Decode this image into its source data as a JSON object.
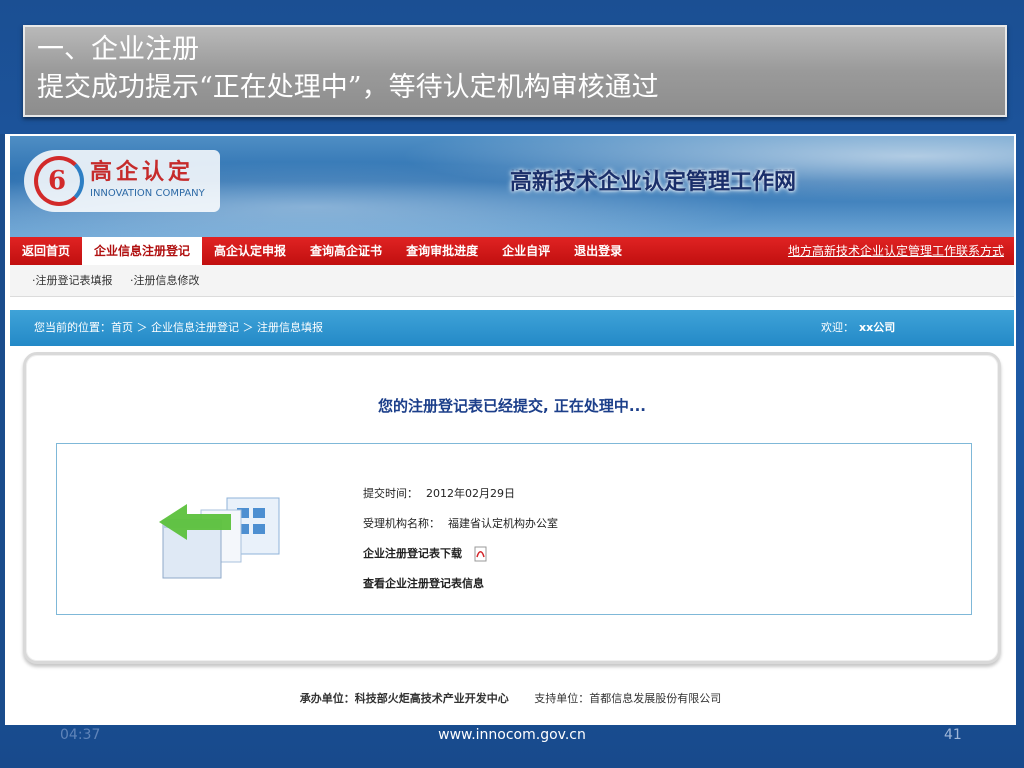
{
  "slide": {
    "title_line1": "一、企业注册",
    "title_line2": "提交成功提示“正在处理中”，等待认定机构审核通过"
  },
  "site": {
    "logo_cn": "高企认定",
    "logo_en": "INNOVATION COMPANY",
    "title": "高新技术企业认定管理工作网"
  },
  "nav": {
    "items": [
      {
        "label": "返回首页"
      },
      {
        "label": "企业信息注册登记"
      },
      {
        "label": "高企认定申报"
      },
      {
        "label": "查询高企证书"
      },
      {
        "label": "查询审批进度"
      },
      {
        "label": "企业自评"
      },
      {
        "label": "退出登录"
      }
    ],
    "contact_link": "地方高新技术企业认定管理工作联系方式"
  },
  "subnav": {
    "items": [
      {
        "label": "·注册登记表填报"
      },
      {
        "label": "·注册信息修改"
      }
    ]
  },
  "breadcrumb": {
    "text": "您当前的位置：首页 ＞ 企业信息注册登记 ＞ 注册信息填报",
    "welcome": "欢迎：",
    "company": "xx公司"
  },
  "panel": {
    "heading": "您的注册登记表已经提交, 正在处理中...",
    "submit_time_label": "提交时间：",
    "submit_time_value": "2012年02月29日",
    "agency_label": "受理机构名称：",
    "agency_value": "福建省认定机构办公室",
    "download_link": "企业注册登记表下载",
    "view_link": "查看企业注册登记表信息"
  },
  "site_footer": {
    "host": "承办单位：科技部火炬高技术产业开发中心",
    "support": "支持单位：首都信息发展股份有限公司"
  },
  "slide_footer": {
    "time": "04:37",
    "url": "www.innocom.gov.cn",
    "page": "41"
  },
  "colors": {
    "nav_red": "#c10f0f",
    "crumb_blue": "#2389c7",
    "heading_blue": "#1c3f8a"
  }
}
